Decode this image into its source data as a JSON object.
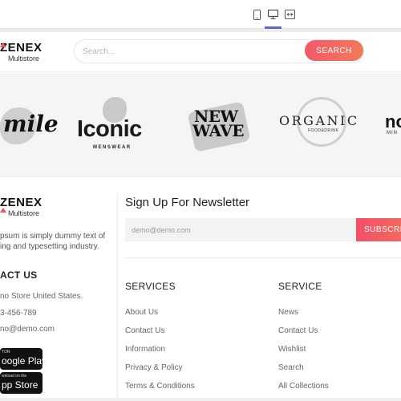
{
  "editor": {
    "devices": [
      "mobile-icon",
      "desktop-icon",
      "fit-width-icon"
    ],
    "active_device": "desktop",
    "accent": "#5a6acf"
  },
  "header": {
    "logo_name": "ZENEX",
    "logo_sub": "Multistore",
    "search_placeholder": "Search...",
    "search_button": "SEARCH"
  },
  "brands": {
    "smile": "mile",
    "iconic": "Iconic",
    "iconic_sub": "MENSWEAR",
    "newwave_1": "NEW",
    "newwave_2": "WAVE",
    "organic": "ORGANIC",
    "organic_sub": "FOOD&DRINK",
    "nom": "no",
    "nom_sub": "MIN"
  },
  "footer": {
    "logo_name": "ZENEX",
    "logo_sub": "Multistore",
    "about_1": "psum is simply dummy text of",
    "about_2": "ing and typesetting industry.",
    "contact_title": "ACT US",
    "address": "no Store United States.",
    "phone": "3-456-789",
    "email": "no@demo.com",
    "google_play_small": "TON",
    "google_play_big": "oogle Play",
    "app_store_small": "wnload on the",
    "app_store_big": "pp Store",
    "newsletter_title": "Sign Up For Newsletter",
    "newsletter_placeholder": "demo@demo.com",
    "subscribe_button": "SUBSCRIBE",
    "services_title": "SERVICES",
    "services_links": [
      "About Us",
      "Contact Us",
      "Information",
      "Privacy & Policy",
      "Terms & Conditions"
    ],
    "service_title": "SERVICE",
    "service_links": [
      "News",
      "Contact Us",
      "Wishlist",
      "Search",
      "All Collections"
    ]
  },
  "colors": {
    "brand_gradient_start": "#f25a6a",
    "brand_gradient_end": "#f27a5a",
    "logo_mark": "#e8565e"
  }
}
